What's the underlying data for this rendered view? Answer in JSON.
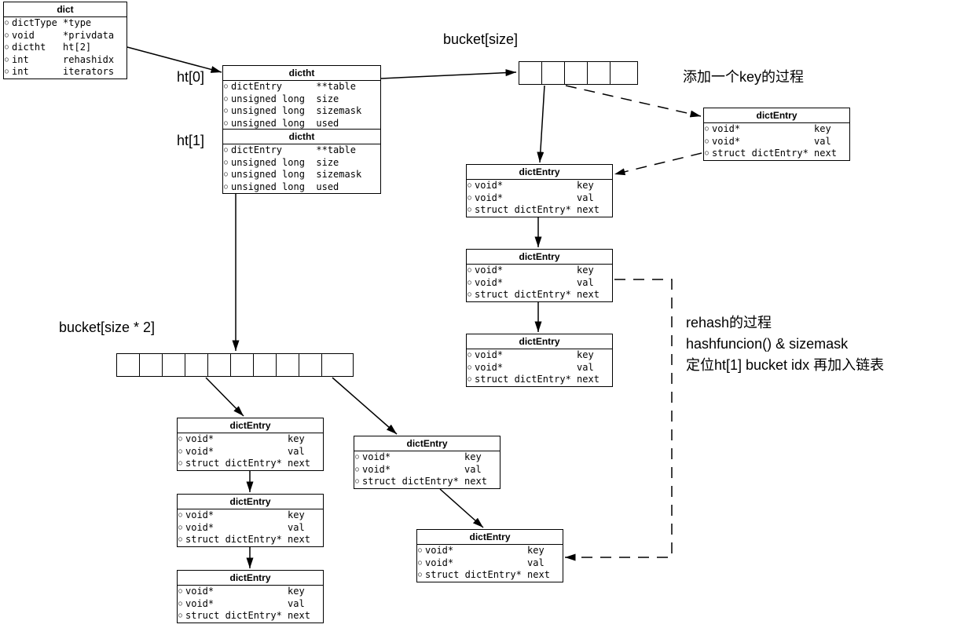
{
  "labels": {
    "ht0": "ht[0]",
    "ht1": "ht[1]",
    "bucketSize": "bucket[size]",
    "bucketSize2": "bucket[size * 2]",
    "addKeyProcess": "添加一个key的过程",
    "rehashLine1": "rehash的过程",
    "rehashLine2": "hashfuncion() & sizemask",
    "rehashLine3": "定位ht[1] bucket idx 再加入链表"
  },
  "boxes": {
    "dict": {
      "title": "dict",
      "rows": [
        "dictType *type",
        "void     *privdata",
        "dictht   ht[2]",
        "int      rehashidx",
        "int      iterators"
      ]
    },
    "dictht0": {
      "title": "dictht",
      "rows": [
        "dictEntry      **table",
        "unsigned long  size",
        "unsigned long  sizemask",
        "unsigned long  used"
      ]
    },
    "dictht1": {
      "title": "dictht",
      "rows": [
        "dictEntry      **table",
        "unsigned long  size",
        "unsigned long  sizemask",
        "unsigned long  used"
      ]
    },
    "entry": {
      "title": "dictEntry",
      "rows": [
        "void*             key",
        "void*             val",
        "struct dictEntry* next"
      ]
    }
  }
}
